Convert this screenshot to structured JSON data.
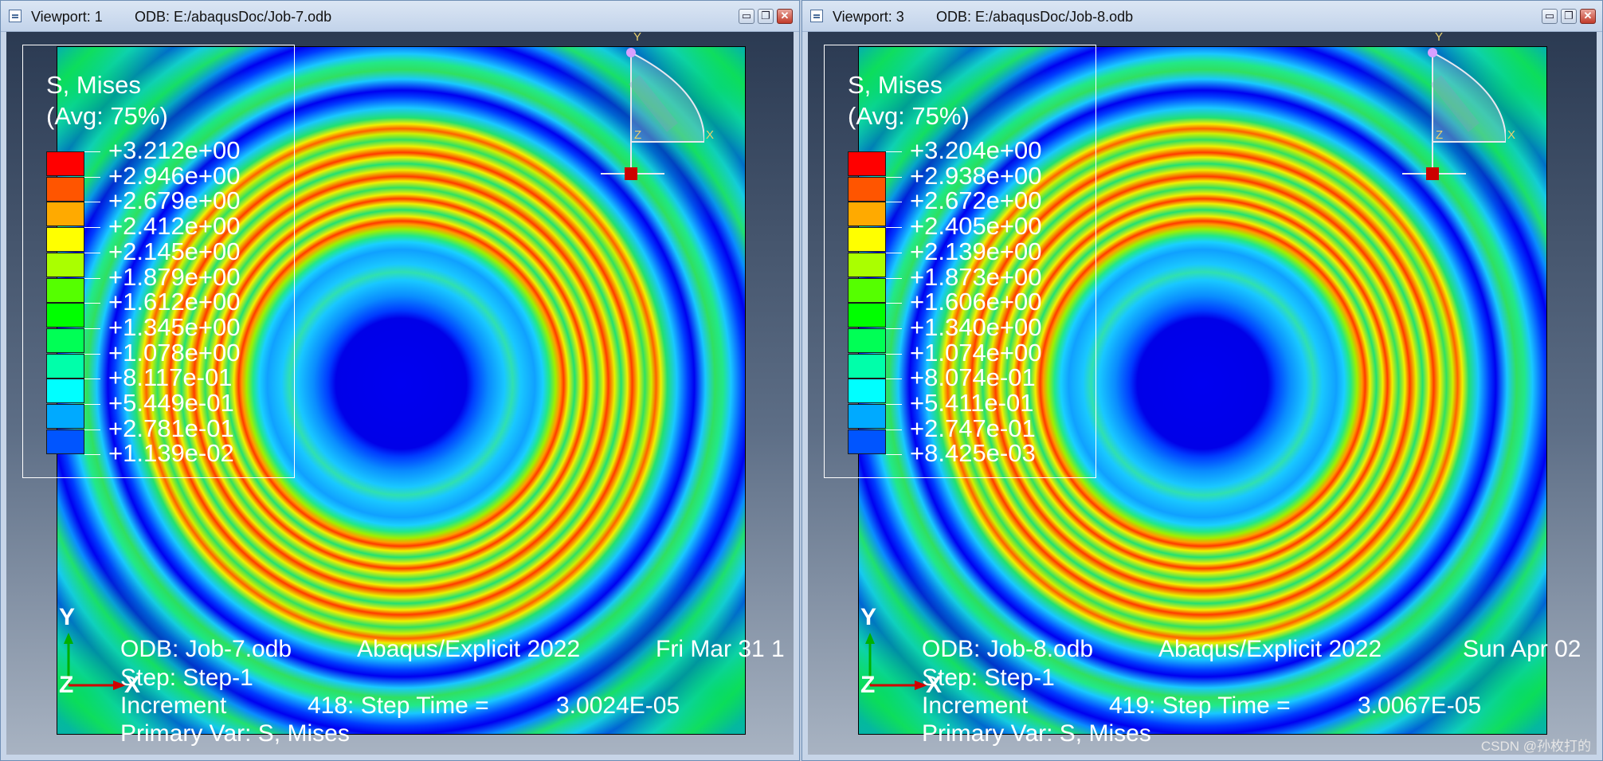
{
  "left": {
    "viewport_label": "Viewport: 1",
    "odb_path": "ODB: E:/abaqusDoc/Job-7.odb",
    "legend_title_1": "S, Mises",
    "legend_title_2": "(Avg: 75%)",
    "legend_values": [
      "+3.212e+00",
      "+2.946e+00",
      "+2.679e+00",
      "+2.412e+00",
      "+2.145e+00",
      "+1.879e+00",
      "+1.612e+00",
      "+1.345e+00",
      "+1.078e+00",
      "+8.117e-01",
      "+5.449e-01",
      "+2.781e-01",
      "+1.139e-02"
    ],
    "info_odb": "ODB: Job-7.odb",
    "info_solver": "Abaqus/Explicit 2022",
    "info_date": "Fri Mar 31 1",
    "info_step": "Step: Step-1",
    "info_increment_label": "Increment",
    "info_increment_value": "418: Step Time =",
    "info_step_time": "3.0024E-05",
    "info_primary_var": "Primary Var: S, Mises"
  },
  "right": {
    "viewport_label": "Viewport: 3",
    "odb_path": "ODB: E:/abaqusDoc/Job-8.odb",
    "legend_title_1": "S, Mises",
    "legend_title_2": "(Avg: 75%)",
    "legend_values": [
      "+3.204e+00",
      "+2.938e+00",
      "+2.672e+00",
      "+2.405e+00",
      "+2.139e+00",
      "+1.873e+00",
      "+1.606e+00",
      "+1.340e+00",
      "+1.074e+00",
      "+8.074e-01",
      "+5.411e-01",
      "+2.747e-01",
      "+8.425e-03"
    ],
    "info_odb": "ODB: Job-8.odb",
    "info_solver": "Abaqus/Explicit 2022",
    "info_date": "Sun Apr 02",
    "info_step": "Step: Step-1",
    "info_increment_label": "Increment",
    "info_increment_value": "419: Step Time =",
    "info_step_time": "3.0067E-05",
    "info_primary_var": "Primary Var: S, Mises"
  },
  "legend_colors": [
    "#ff0000",
    "#ff5500",
    "#ffaa00",
    "#ffff00",
    "#aaff00",
    "#55ff00",
    "#00ff00",
    "#00ff55",
    "#00ffaa",
    "#00ffff",
    "#00aaff",
    "#0055ff",
    "#0000ff"
  ],
  "triad3d_labels": {
    "y": "Y",
    "x": "X",
    "z": "Z"
  },
  "axis_labels": {
    "y": "Y",
    "z": "Z",
    "x": "X"
  },
  "window_controls": {
    "minimize": "▭",
    "restore": "❐",
    "close": "✕"
  },
  "watermark": "CSDN @孙枚打的"
}
